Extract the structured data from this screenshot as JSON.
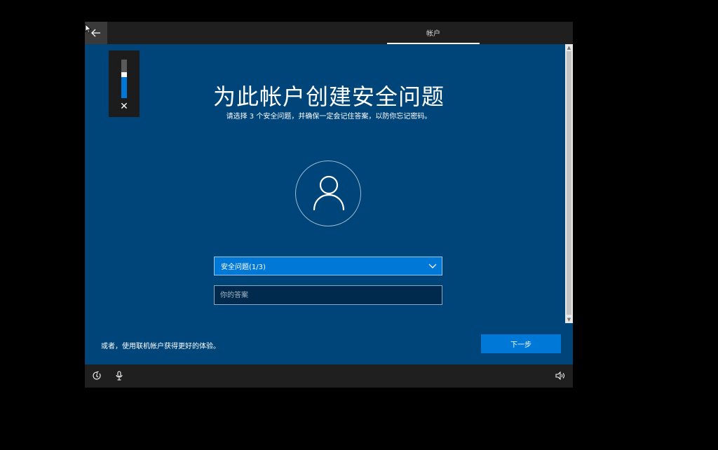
{
  "header": {
    "back_icon": "arrow-left-icon",
    "tab_label": "帐户"
  },
  "volume_flyout": {
    "level": 0.55,
    "close_icon": "close-icon"
  },
  "main": {
    "title": "为此帐户创建安全问题",
    "subtitle": "请选择 3 个安全问题，并确保一定会记住答案，以防你忘记密码。",
    "avatar_icon": "user-icon",
    "question_dropdown": {
      "selected": "安全问题(1/3)",
      "icon": "chevron-down-icon"
    },
    "answer_field": {
      "value": "",
      "placeholder": "你的答案"
    }
  },
  "footer": {
    "online_link": "或者，使用联机帐户获得更好的体验。",
    "next_button": "下一步"
  },
  "taskbar": {
    "icons": [
      "accessibility-icon",
      "microphone-icon",
      "speaker-icon"
    ]
  },
  "colors": {
    "background": "#00457a",
    "accent": "#0078d7",
    "bar": "#1f1f1f"
  }
}
